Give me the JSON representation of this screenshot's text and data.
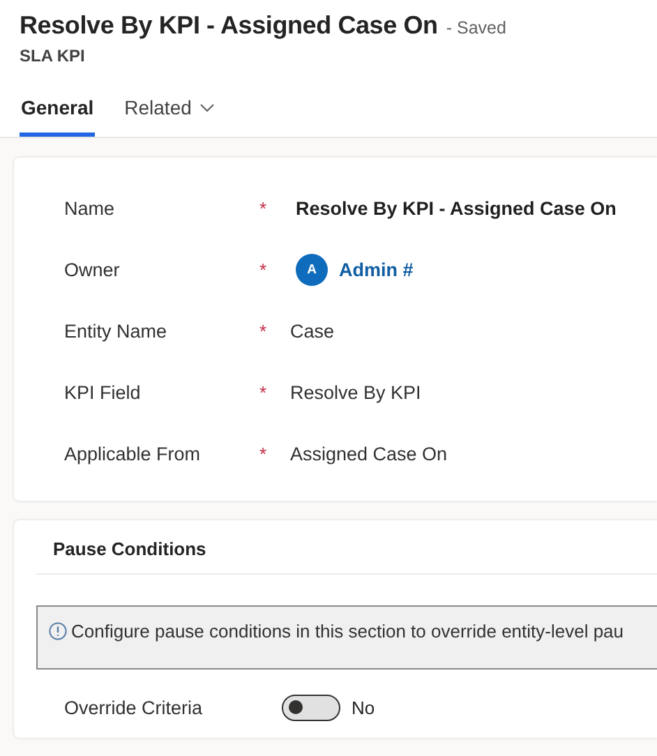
{
  "header": {
    "title": "Resolve By KPI - Assigned Case On",
    "status": "- Saved",
    "entity": "SLA KPI"
  },
  "tabs": [
    {
      "label": "General",
      "selected": true,
      "kind": "plain"
    },
    {
      "label": "Related",
      "selected": false,
      "kind": "dropdown"
    }
  ],
  "fields": [
    {
      "label": "Name",
      "required_mark": "*",
      "kind": "primary",
      "value": "Resolve By KPI - Assigned Case On"
    },
    {
      "label": "Owner",
      "required_mark": "*",
      "kind": "lookup",
      "initial": "A",
      "value": "Admin #"
    },
    {
      "label": "Entity Name",
      "required_mark": "*",
      "kind": "text",
      "value": "Case"
    },
    {
      "label": "KPI Field",
      "required_mark": "*",
      "kind": "text",
      "value": "Resolve By KPI"
    },
    {
      "label": "Applicable From",
      "required_mark": "*",
      "kind": "text",
      "value": "Assigned Case On"
    }
  ],
  "pause_section": {
    "title": "Pause Conditions",
    "info": "Configure pause conditions in this section to override entity-level pau",
    "toggle": {
      "label": "Override Criteria",
      "on": false,
      "state_text": "No"
    }
  }
}
